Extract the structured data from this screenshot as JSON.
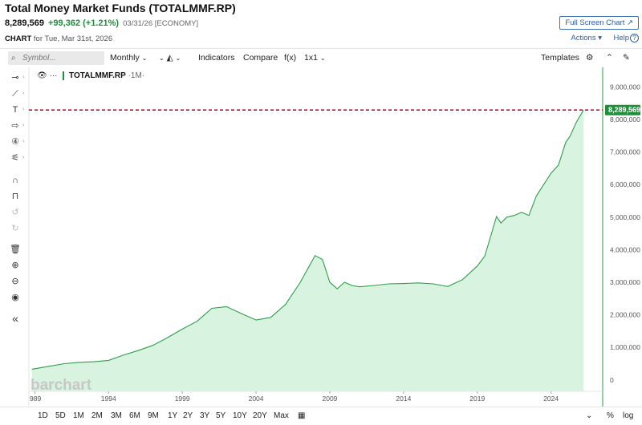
{
  "header": {
    "title": "Total Money Market Funds (TOTALMMF.RP)",
    "last": "8,289,569",
    "change": "+99,362 (+1.21%)",
    "date_meta": "03/31/26 [ECONOMY]",
    "chart_label": "CHART",
    "chart_for": "for Tue, Mar 31st, 2026",
    "fullscreen": "Full Screen Chart",
    "actions": "Actions",
    "help": "Help"
  },
  "toolbar": {
    "symbol_placeholder": "Symbol...",
    "period": "Monthly",
    "indicators": "Indicators",
    "compare": "Compare",
    "fx": "f(x)",
    "layout": "1x1",
    "templates": "Templates"
  },
  "legend": {
    "symbol": "TOTALMMF.RP",
    "period": "·1M·"
  },
  "watermark": "barchart",
  "bottom": {
    "periods": [
      "1D",
      "5D",
      "1M",
      "2M",
      "3M",
      "6M",
      "9M",
      "1Y",
      "2Y",
      "3Y",
      "5Y",
      "10Y",
      "20Y",
      "Max"
    ],
    "percent": "%",
    "log": "log"
  },
  "colors": {
    "line": "#2e9e4a",
    "fill": "#d8f3df",
    "current": "#c8102e",
    "badge": "#1e8f3a",
    "accent": "#2b5ea7"
  },
  "chart_data": {
    "type": "area",
    "x": [
      1988.8,
      1990,
      1991,
      1992,
      1993,
      1994,
      1995,
      1996,
      1997,
      1998,
      1999,
      2000,
      2001,
      2002,
      2003,
      2004,
      2005,
      2006,
      2007,
      2008,
      2008.5,
      2009,
      2009.5,
      2010,
      2010.5,
      2011,
      2012,
      2013,
      2014,
      2015,
      2016,
      2017,
      2018,
      2019,
      2019.5,
      2020,
      2020.3,
      2020.6,
      2021,
      2021.5,
      2022,
      2022.5,
      2023,
      2023.5,
      2024,
      2024.5,
      2025,
      2025.3,
      2025.7,
      2026.2
    ],
    "values": [
      330000,
      420000,
      500000,
      540000,
      560000,
      600000,
      760000,
      900000,
      1060000,
      1300000,
      1560000,
      1800000,
      2200000,
      2250000,
      2040000,
      1840000,
      1920000,
      2320000,
      3000000,
      3820000,
      3700000,
      3000000,
      2800000,
      3000000,
      2900000,
      2860000,
      2900000,
      2950000,
      2960000,
      2980000,
      2950000,
      2870000,
      3080000,
      3500000,
      3800000,
      4550000,
      5020000,
      4820000,
      5000000,
      5050000,
      5150000,
      5050000,
      5650000,
      6000000,
      6350000,
      6600000,
      7300000,
      7500000,
      7900000,
      8289569
    ],
    "current_value": "8,289,569",
    "x_ticks": [
      1989,
      1994,
      1999,
      2004,
      2009,
      2014,
      2019,
      2024
    ],
    "x_tick_labels": [
      "989",
      "1994",
      "1999",
      "2004",
      "2009",
      "2014",
      "2019",
      "2024"
    ],
    "y_ticks": [
      0,
      1000000,
      2000000,
      3000000,
      4000000,
      5000000,
      6000000,
      7000000,
      8000000,
      9000000
    ],
    "y_tick_labels": [
      "0",
      "1,000,000",
      "2,000,000",
      "3,000,000",
      "4,000,000",
      "5,000,000",
      "6,000,000",
      "7,000,000",
      "8,000,000",
      "9,000,000"
    ],
    "xlim": [
      1988.6,
      2027.5
    ],
    "ylim": [
      -350000,
      9600000
    ],
    "title": "",
    "xlabel": "",
    "ylabel": "",
    "grid": false
  }
}
